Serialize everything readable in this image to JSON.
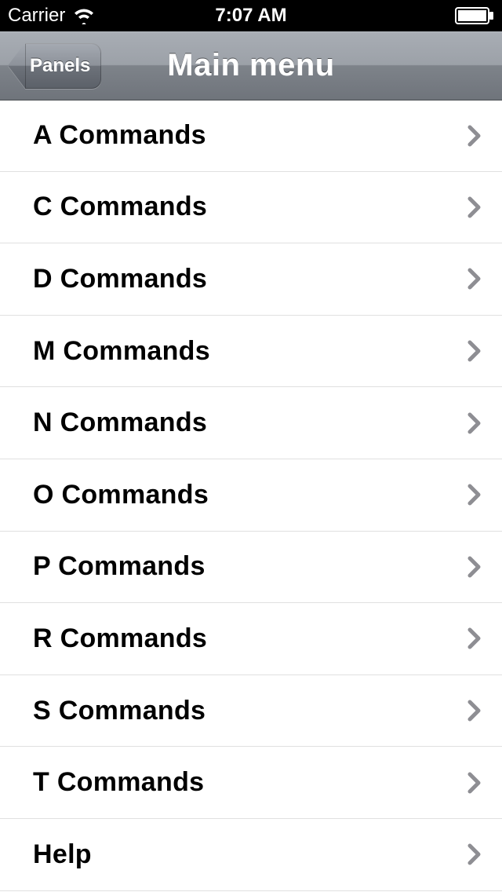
{
  "status_bar": {
    "carrier": "Carrier",
    "time": "7:07 AM"
  },
  "nav": {
    "back_label": "Panels",
    "title": "Main menu"
  },
  "list": {
    "items": [
      {
        "label": "A Commands"
      },
      {
        "label": "C Commands"
      },
      {
        "label": "D Commands"
      },
      {
        "label": "M Commands"
      },
      {
        "label": "N Commands"
      },
      {
        "label": "O Commands"
      },
      {
        "label": "P Commands"
      },
      {
        "label": "R Commands"
      },
      {
        "label": "S Commands"
      },
      {
        "label": "T Commands"
      },
      {
        "label": "Help"
      }
    ]
  }
}
